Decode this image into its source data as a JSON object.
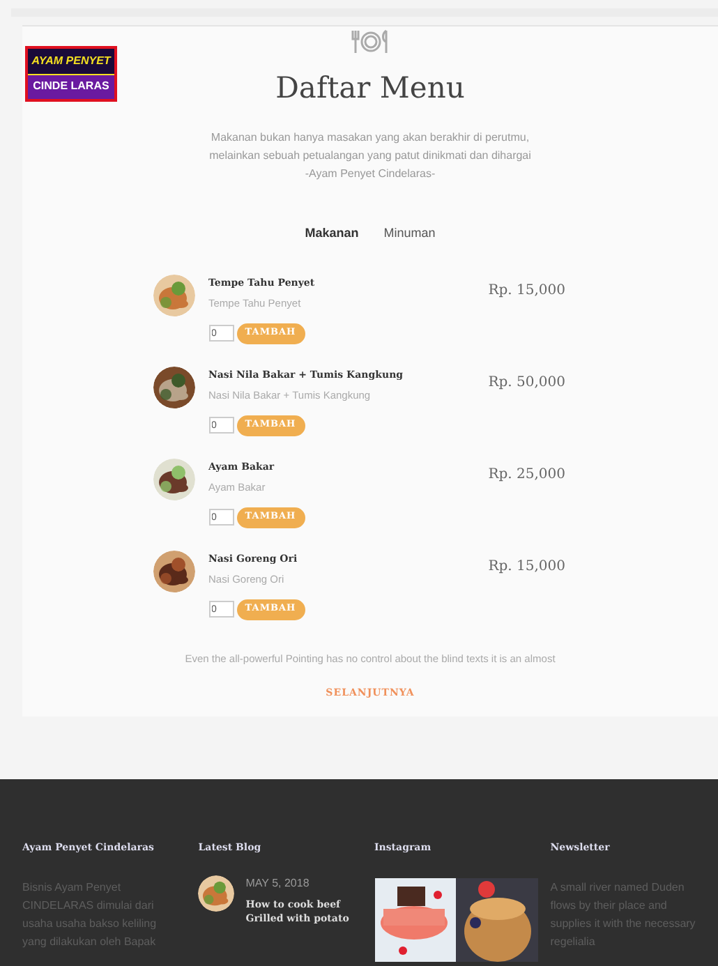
{
  "logo": {
    "line_1": "AYAM PENYET",
    "line_2": "CINDE LARAS"
  },
  "title": "Daftar Menu",
  "intro": [
    "Makanan bukan hanya masakan yang akan berakhir di perutmu, melainkan sebuah petualangan yang patut dinikmati dan dihargai",
    "-Ayam Penyet Cindelaras-"
  ],
  "tabs": [
    {
      "label": "Makanan",
      "selected": true
    },
    {
      "label": "Minuman",
      "selected": false
    }
  ],
  "menu_items": [
    {
      "name": "Tempe Tahu Penyet",
      "description": "Tempe Tahu Penyet",
      "price": "Rp. 15,000",
      "quantity": "0",
      "button": "TAMBAH"
    },
    {
      "name": "Nasi Nila Bakar + Tumis Kangkung",
      "description": "Nasi Nila Bakar + Tumis Kangkung",
      "price": "Rp. 50,000",
      "quantity": "0",
      "button": "TAMBAH"
    },
    {
      "name": "Ayam Bakar",
      "description": "Ayam Bakar",
      "price": "Rp. 25,000",
      "quantity": "0",
      "button": "TAMBAH"
    },
    {
      "name": "Nasi Goreng Ori",
      "description": "Nasi Goreng Ori",
      "price": "Rp. 15,000",
      "quantity": "0",
      "button": "TAMBAH"
    }
  ],
  "footer_note": "Even the all-powerful Pointing has no control about the blind texts it is an almost",
  "next_link": "SELANJUTNYA",
  "footer": {
    "about": {
      "heading": "Ayam Penyet Cindelaras",
      "text": "Bisnis Ayam Penyet CINDELARAS dimulai dari usaha usaha bakso keliling yang dilakukan oleh Bapak"
    },
    "blog": {
      "heading": "Latest Blog",
      "date": "MAY 5, 2018",
      "post_title": "How to cook beef Grilled with potato"
    },
    "instagram": {
      "heading": "Instagram"
    },
    "newsletter": {
      "heading": "Newsletter",
      "text": "A small river named Duden flows by their place and supplies it with the necessary regelialia"
    }
  }
}
